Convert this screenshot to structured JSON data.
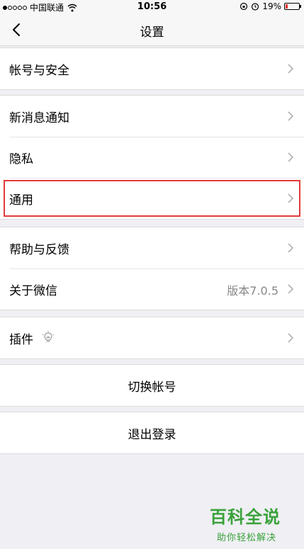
{
  "status_bar": {
    "carrier": "中国联通",
    "time": "10:56",
    "battery_percent": "19%",
    "battery_level": 0.19,
    "signal_bars": 1
  },
  "nav": {
    "title": "设置"
  },
  "groups": {
    "account": {
      "account_security": "帐号与安全"
    },
    "main": {
      "new_message_notification": "新消息通知",
      "privacy": "隐私",
      "general": "通用"
    },
    "help": {
      "help_feedback": "帮助与反馈",
      "about_wechat": "关于微信",
      "version": "版本7.0.5"
    },
    "plugins": {
      "plugins": "插件"
    },
    "switch": {
      "switch_account": "切换帐号"
    },
    "logout": {
      "logout": "退出登录"
    }
  },
  "watermark": {
    "title": "百科全说",
    "subtitle": "助你轻松解决"
  },
  "colors": {
    "highlight": "#e23b3b",
    "battery_low": "#e0302a",
    "watermark": "#3aa23a",
    "background": "#efeff4"
  },
  "icons": {
    "back": "chevron-left-icon",
    "disclosure": "chevron-right-icon",
    "plugin": "lightbulb-icon",
    "wifi": "wifi-icon",
    "alarm": "alarm-icon"
  }
}
